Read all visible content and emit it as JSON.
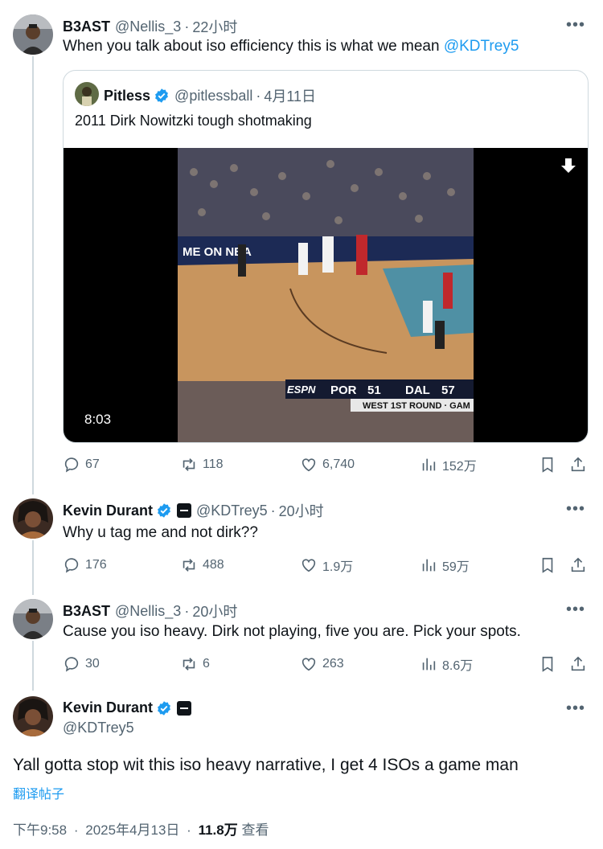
{
  "tweets": [
    {
      "name": "B3AST",
      "handle": "@Nellis_3",
      "time": "22小时",
      "text": "When you talk about iso efficiency this is what we mean ",
      "mention": "@KDTrey5",
      "quote": {
        "name": "Pitless",
        "handle": "@pitlessball",
        "time": "4月11日",
        "text": "2011 Dirk Nowitzki tough shotmaking",
        "video_duration": "8:03",
        "scoreboard": {
          "network": "ESPN",
          "team1": "POR",
          "score1": "51",
          "team2": "DAL",
          "score2": "57",
          "round": "WEST 1ST ROUND · GAM"
        },
        "banner_text": "ME ON NBA"
      },
      "stats": {
        "replies": "67",
        "retweets": "118",
        "likes": "6,740",
        "views": "152万"
      }
    },
    {
      "name": "Kevin Durant",
      "handle": "@KDTrey5",
      "time": "20小时",
      "text": "Why u tag me and not dirk??",
      "stats": {
        "replies": "176",
        "retweets": "488",
        "likes": "1.9万",
        "views": "59万"
      }
    },
    {
      "name": "B3AST",
      "handle": "@Nellis_3",
      "time": "20小时",
      "text": "Cause you iso heavy. Dirk not playing, five you are. Pick your spots.",
      "stats": {
        "replies": "30",
        "retweets": "6",
        "likes": "263",
        "views": "8.6万"
      }
    }
  ],
  "main": {
    "name": "Kevin Durant",
    "handle": "@KDTrey5",
    "text": "Yall gotta stop wit this iso heavy narrative, I get 4 ISOs a game man",
    "translate": "翻译帖子",
    "time": "下午9:58",
    "date": "2025年4月13日",
    "views": "11.8万",
    "views_label": "查看"
  },
  "sep": "·",
  "more": "•••",
  "colors": {
    "accent": "#1d9bf0",
    "secondary": "#536471",
    "border": "#cfd9de"
  }
}
